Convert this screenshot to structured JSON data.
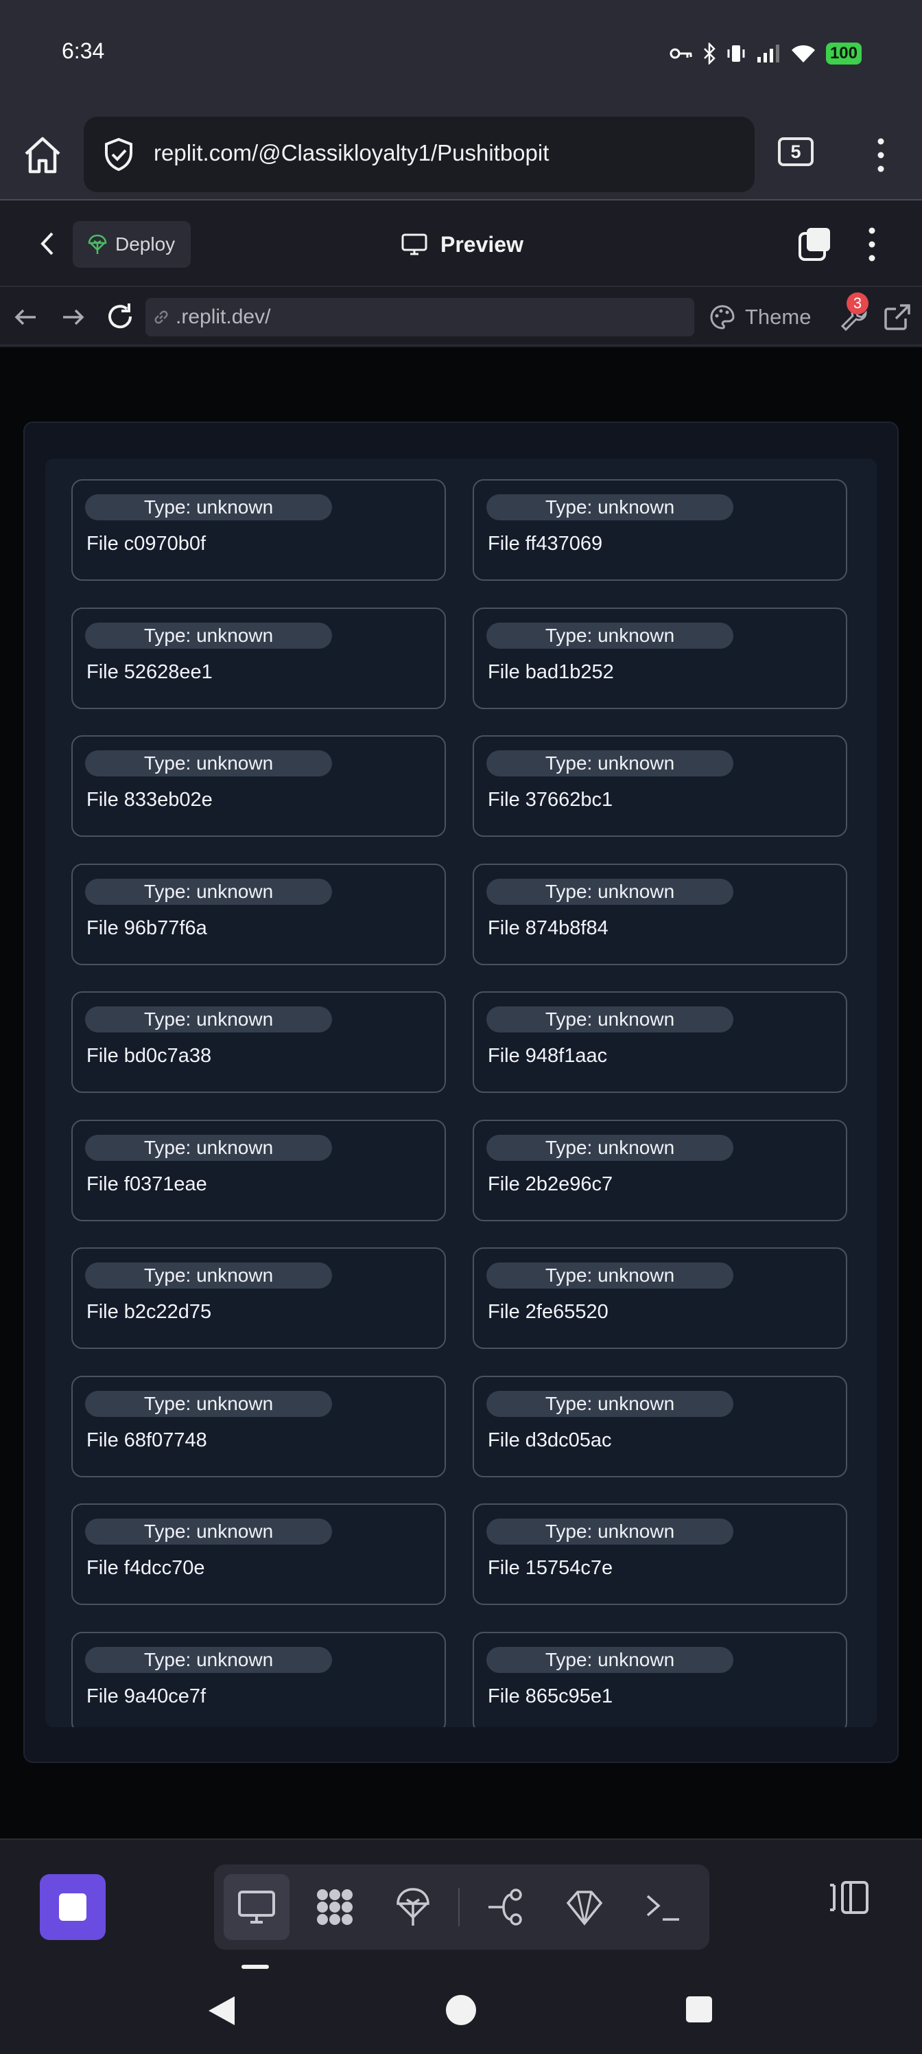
{
  "status_bar": {
    "time": "6:34",
    "battery": "100"
  },
  "browser": {
    "url": "replit.com/@Classikloyalty1/Pushitbopit",
    "tab_count": "5"
  },
  "replit_header": {
    "deploy_label": "Deploy",
    "preview_label": "Preview"
  },
  "address_bar": {
    "address": ".replit.dev/",
    "theme_label": "Theme",
    "devtools_badge": "3"
  },
  "files": [
    {
      "type": "Type: unknown",
      "name": "File c0970b0f"
    },
    {
      "type": "Type: unknown",
      "name": "File ff437069"
    },
    {
      "type": "Type: unknown",
      "name": "File 52628ee1"
    },
    {
      "type": "Type: unknown",
      "name": "File bad1b252"
    },
    {
      "type": "Type: unknown",
      "name": "File 833eb02e"
    },
    {
      "type": "Type: unknown",
      "name": "File 37662bc1"
    },
    {
      "type": "Type: unknown",
      "name": "File 96b77f6a"
    },
    {
      "type": "Type: unknown",
      "name": "File 874b8f84"
    },
    {
      "type": "Type: unknown",
      "name": "File bd0c7a38"
    },
    {
      "type": "Type: unknown",
      "name": "File 948f1aac"
    },
    {
      "type": "Type: unknown",
      "name": "File f0371eae"
    },
    {
      "type": "Type: unknown",
      "name": "File 2b2e96c7"
    },
    {
      "type": "Type: unknown",
      "name": "File b2c22d75"
    },
    {
      "type": "Type: unknown",
      "name": "File 2fe65520"
    },
    {
      "type": "Type: unknown",
      "name": "File 68f07748"
    },
    {
      "type": "Type: unknown",
      "name": "File d3dc05ac"
    },
    {
      "type": "Type: unknown",
      "name": "File f4dcc70e"
    },
    {
      "type": "Type: unknown",
      "name": "File 15754c7e"
    },
    {
      "type": "Type: unknown",
      "name": "File 9a40ce7f"
    },
    {
      "type": "Type: unknown",
      "name": "File 865c95e1"
    }
  ],
  "bottom_toolbar": {
    "tools": [
      "preview-icon",
      "apps-icon",
      "deploy-icon",
      "git-icon",
      "agent-icon",
      "console-icon"
    ]
  }
}
